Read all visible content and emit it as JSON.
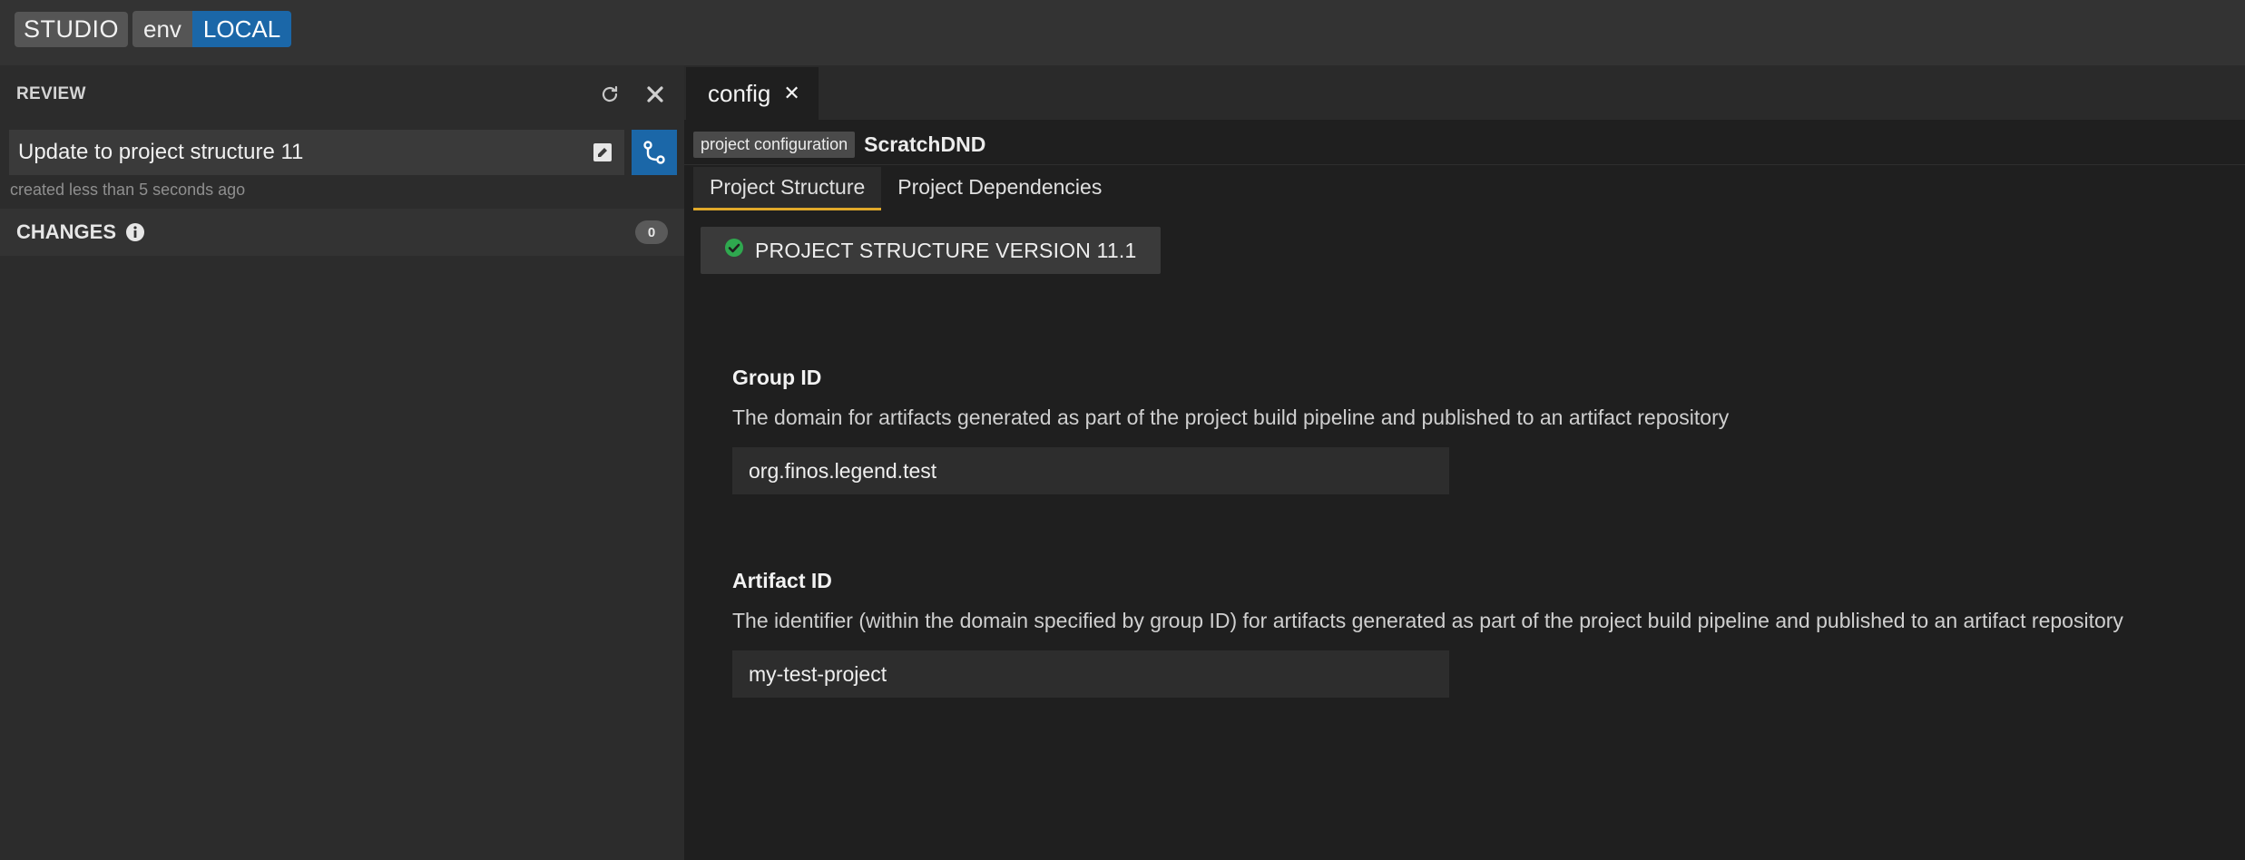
{
  "app": {
    "name": "STUDIO",
    "env_key": "env",
    "env_value": "LOCAL"
  },
  "sidebar": {
    "title": "REVIEW",
    "refresh_icon": "refresh-icon",
    "close_icon": "close-icon",
    "review_title": "Update to project structure 11",
    "created_text": "created less than 5 seconds ago",
    "changes_label": "CHANGES",
    "changes_count": "0"
  },
  "tabs": [
    {
      "label": "config",
      "active": true
    }
  ],
  "breadcrumb": {
    "tag": "project configuration",
    "name": "ScratchDND"
  },
  "subtabs": [
    {
      "label": "Project Structure",
      "active": true
    },
    {
      "label": "Project Dependencies",
      "active": false
    }
  ],
  "version": {
    "text": "PROJECT STRUCTURE VERSION 11.1",
    "status_color": "#2fa84f"
  },
  "fields": {
    "group": {
      "label": "Group ID",
      "description": "The domain for artifacts generated as part of the project build pipeline and published to an artifact repository",
      "value": "org.finos.legend.test"
    },
    "artifact": {
      "label": "Artifact ID",
      "description": "The identifier (within the domain specified by group ID) for artifacts generated as part of the project build pipeline and published to an artifact repository",
      "value": "my-test-project"
    }
  },
  "colors": {
    "accent": "#1b67a8",
    "tab_underline": "#e0a92a"
  }
}
